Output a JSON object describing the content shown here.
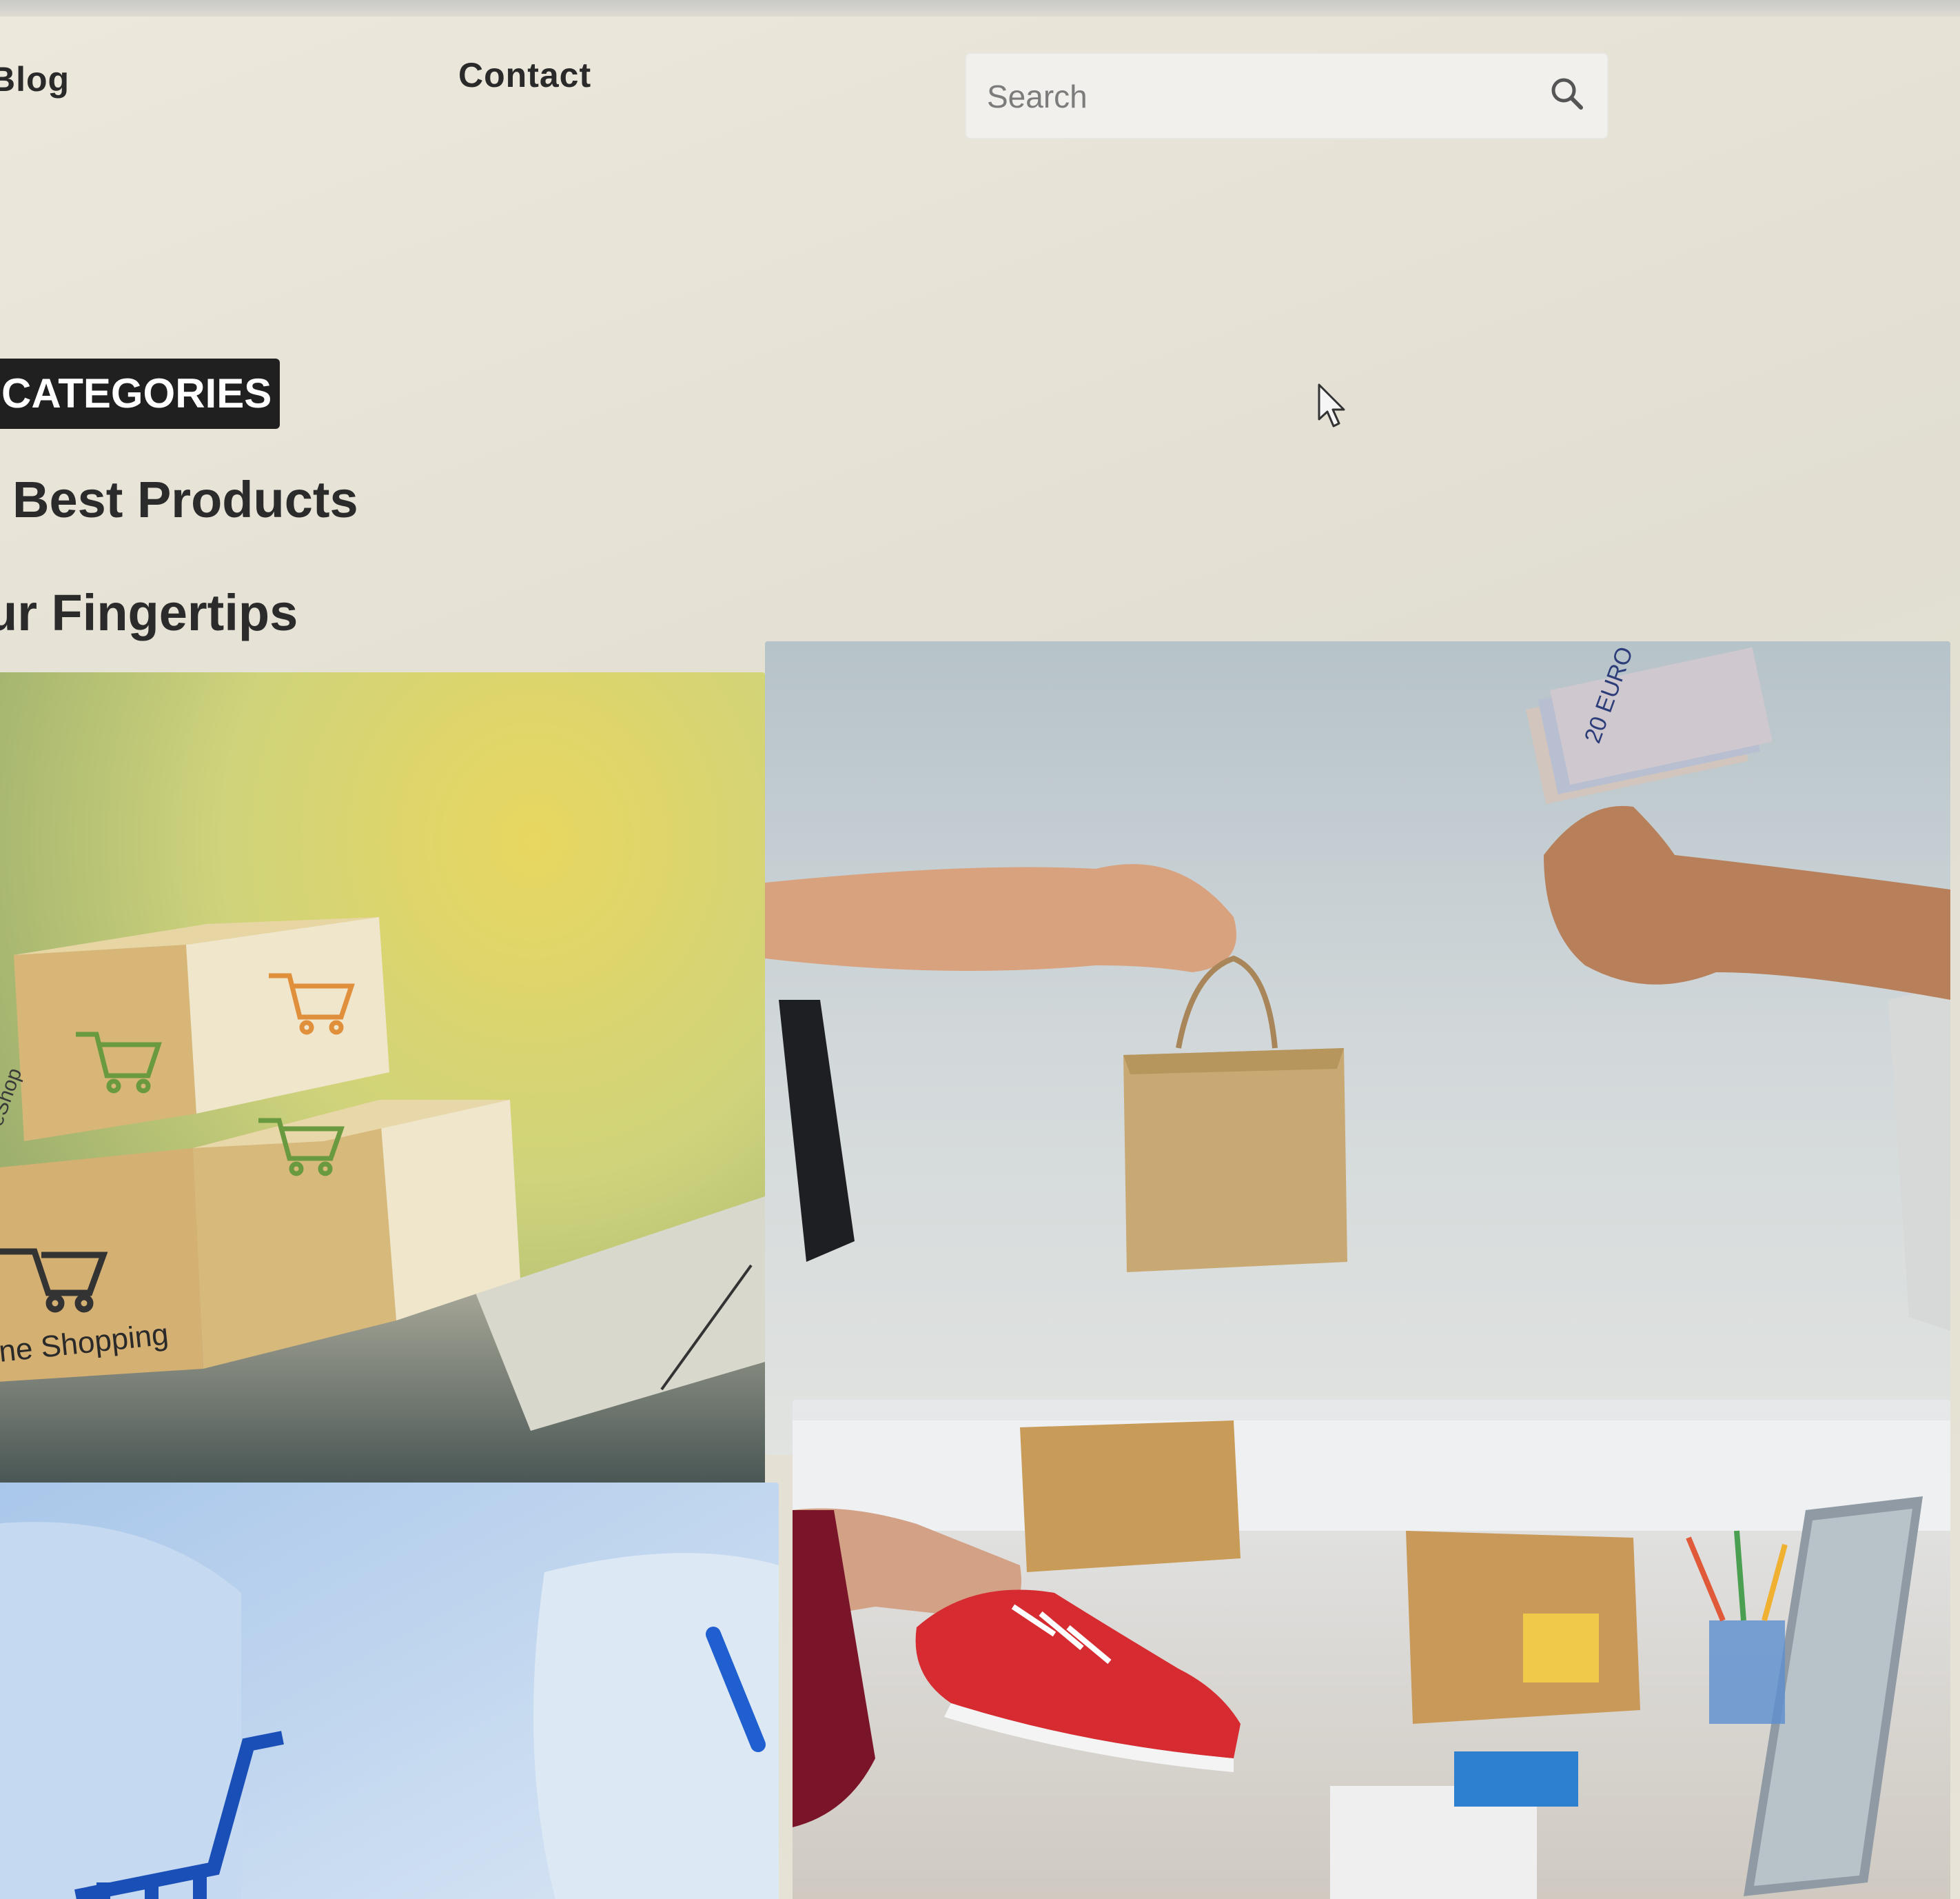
{
  "nav": {
    "blog_label": "Blog",
    "contact_label": "Contact"
  },
  "search": {
    "placeholder": "Search",
    "icon": "search-icon"
  },
  "hero": {
    "badge": "CATEGORIES",
    "line1": "Best Products",
    "line2": "ur Fingertips"
  },
  "tiles": [
    {
      "name": "tile-shipping-boxes",
      "caption": "ne Shopping",
      "box_text": "eShop"
    },
    {
      "name": "tile-bag-for-cash",
      "banknote_label": "20 EURO"
    },
    {
      "name": "tile-cart-key"
    },
    {
      "name": "tile-shoe-packing"
    }
  ],
  "colors": {
    "background": "#e6e2d6",
    "badge_bg": "#202020",
    "text": "#2b2b2b"
  }
}
